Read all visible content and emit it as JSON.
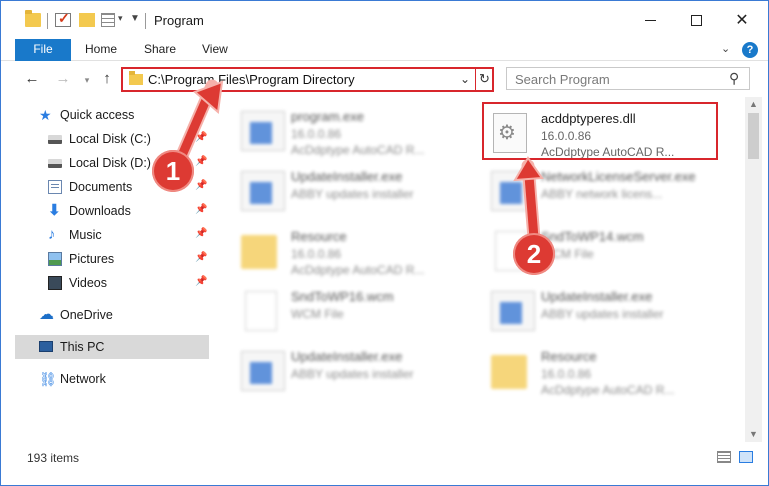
{
  "window": {
    "title": "Program",
    "minimize_label": "",
    "maximize_label": "",
    "close_label": "✕"
  },
  "ribbon": {
    "tabs": [
      "File",
      "Home",
      "Share",
      "View"
    ]
  },
  "address": {
    "path": "C:\\Program Files\\Program Directory"
  },
  "search": {
    "placeholder": "Search Program"
  },
  "sidebar": {
    "items": [
      {
        "label": "Quick access",
        "icon": "star-icon",
        "pinned": false
      },
      {
        "label": "Local Disk (C:)",
        "icon": "disk-icon",
        "pinned": true
      },
      {
        "label": "Local Disk (D:)",
        "icon": "disk-icon",
        "pinned": true
      },
      {
        "label": "Documents",
        "icon": "documents-icon",
        "pinned": true
      },
      {
        "label": "Downloads",
        "icon": "downloads-icon",
        "pinned": true
      },
      {
        "label": "Music",
        "icon": "music-icon",
        "pinned": true
      },
      {
        "label": "Pictures",
        "icon": "pictures-icon",
        "pinned": true
      },
      {
        "label": "Videos",
        "icon": "videos-icon",
        "pinned": true
      },
      {
        "label": "OneDrive",
        "icon": "cloud-icon",
        "pinned": false
      },
      {
        "label": "This PC",
        "icon": "pc-icon",
        "pinned": false,
        "selected": true
      },
      {
        "label": "Network",
        "icon": "network-icon",
        "pinned": false
      }
    ]
  },
  "files": [
    {
      "name": "program.exe",
      "line1": "16.0.0.86",
      "line2": "AcDdptype AutoCAD R...",
      "kind": "exe",
      "blurred": true
    },
    {
      "name": "acddptyperes.dll",
      "line1": "16.0.0.86",
      "line2": "AcDdptype AutoCAD R...",
      "kind": "dll",
      "blurred": false
    },
    {
      "name": "UpdateInstaller.exe",
      "line1": "ABBY updates installer",
      "line2": "",
      "kind": "exe",
      "blurred": true
    },
    {
      "name": "NetworkLicenseServer.exe",
      "line1": "ABBY network licens...",
      "line2": "",
      "kind": "exe",
      "blurred": true
    },
    {
      "name": "Resource",
      "line1": "16.0.0.86",
      "line2": "AcDdptype AutoCAD R...",
      "kind": "folder",
      "blurred": true
    },
    {
      "name": "SndToWP14.wcm",
      "line1": "WCM File",
      "line2": "",
      "kind": "file",
      "blurred": true
    },
    {
      "name": "SndToWP16.wcm",
      "line1": "WCM File",
      "line2": "",
      "kind": "file",
      "blurred": true
    },
    {
      "name": "UpdateInstaller.exe",
      "line1": "ABBY updates installer",
      "line2": "",
      "kind": "exe",
      "blurred": true
    },
    {
      "name": "UpdateInstaller.exe",
      "line1": "ABBY updates installer",
      "line2": "",
      "kind": "exe",
      "blurred": true
    },
    {
      "name": "Resource",
      "line1": "16.0.0.86",
      "line2": "AcDdptype AutoCAD R...",
      "kind": "folder",
      "blurred": true
    }
  ],
  "status": {
    "item_count": "193 items"
  },
  "annotations": {
    "step1": "1",
    "step2": "2"
  },
  "colors": {
    "accent": "#1979ca",
    "highlight": "#d8262c",
    "badge": "#dd3a33"
  }
}
